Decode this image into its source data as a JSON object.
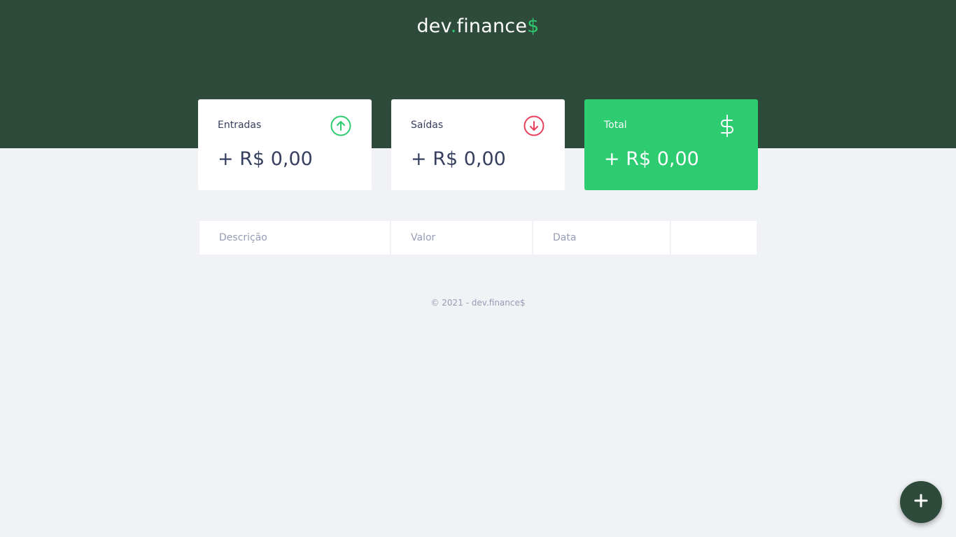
{
  "header": {
    "logo_part1": "dev",
    "logo_dot": ".",
    "logo_part2": "finance",
    "logo_symbol": "$"
  },
  "cards": [
    {
      "title": "Entradas",
      "value": "+ R$ 0,00",
      "icon": "arrow-up-circle-icon"
    },
    {
      "title": "Saídas",
      "value": "+ R$ 0,00",
      "icon": "arrow-down-circle-icon"
    },
    {
      "title": "Total",
      "value": "+ R$ 0,00",
      "icon": "dollar-icon"
    }
  ],
  "table": {
    "columns": [
      "Descrição",
      "Valor",
      "Data",
      ""
    ]
  },
  "footer": {
    "text": "© 2021 - dev.finance$"
  },
  "fab": {
    "icon": "plus-icon"
  },
  "colors": {
    "header_bg": "#2d4a3a",
    "accent_green": "#2ecc71",
    "expense_red": "#e83f5b",
    "page_bg": "#f0f2f5"
  }
}
